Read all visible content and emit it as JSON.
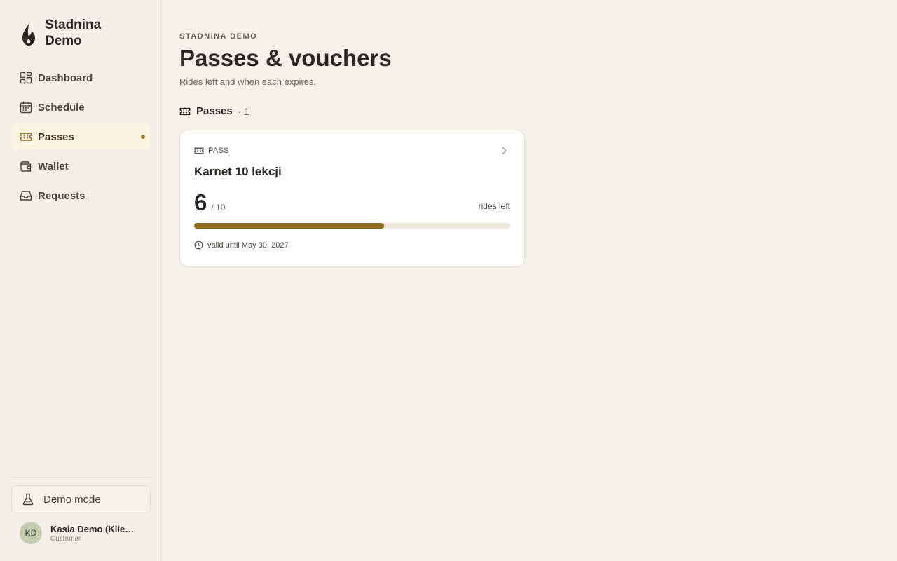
{
  "brand": {
    "name": "Stadnina Demo",
    "logo_icon": "flame-logo-icon"
  },
  "sidebar": {
    "items": [
      {
        "label": "Dashboard",
        "icon": "dashboard-icon",
        "active": false
      },
      {
        "label": "Schedule",
        "icon": "calendar-icon",
        "active": false
      },
      {
        "label": "Passes",
        "icon": "ticket-icon",
        "active": true
      },
      {
        "label": "Wallet",
        "icon": "wallet-icon",
        "active": false
      },
      {
        "label": "Requests",
        "icon": "inbox-icon",
        "active": false
      }
    ],
    "demo_mode_label": "Demo mode",
    "user": {
      "initials": "KD",
      "name": "Kasia Demo (Klie…",
      "role": "Customer"
    }
  },
  "header": {
    "eyebrow": "STADNINA DEMO",
    "title": "Passes & vouchers",
    "subtitle": "Rides left and when each expires."
  },
  "section": {
    "title": "Passes",
    "count": "· 1"
  },
  "pass_card": {
    "type_label": "PASS",
    "title": "Karnet 10 lekcji",
    "rides_left": "6",
    "rides_total": "/ 10",
    "rides_left_label": "rides left",
    "progress_fraction": 0.6,
    "validity": "valid until May 30, 2027"
  },
  "colors": {
    "accent": "#8f6b1a",
    "active_nav_bg": "#fbf4e2",
    "background": "#f5f1ea"
  }
}
